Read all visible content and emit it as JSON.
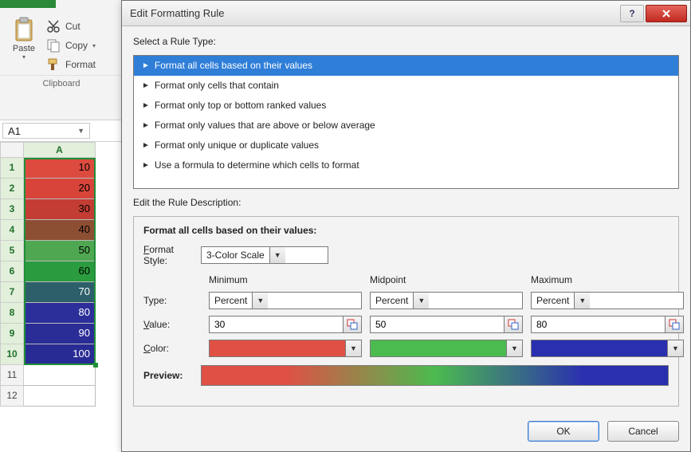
{
  "ribbon": {
    "paste_label": "Paste",
    "cut_label": "Cut",
    "copy_label": "Copy",
    "format_label": "Format",
    "clipboard_label": "Clipboard"
  },
  "name_box": "A1",
  "grid": {
    "col": "A",
    "rows": [
      {
        "n": "1",
        "v": "10",
        "bg": "#dd4a3e",
        "fg": "#000"
      },
      {
        "n": "2",
        "v": "20",
        "bg": "#d8443a",
        "fg": "#000"
      },
      {
        "n": "3",
        "v": "30",
        "bg": "#c33d34",
        "fg": "#000"
      },
      {
        "n": "4",
        "v": "40",
        "bg": "#8d4f33",
        "fg": "#000"
      },
      {
        "n": "5",
        "v": "50",
        "bg": "#4fa851",
        "fg": "#000"
      },
      {
        "n": "6",
        "v": "60",
        "bg": "#2a9b3e",
        "fg": "#000"
      },
      {
        "n": "7",
        "v": "70",
        "bg": "#2d5f6a",
        "fg": "#fff"
      },
      {
        "n": "8",
        "v": "80",
        "bg": "#2c2f99",
        "fg": "#fff"
      },
      {
        "n": "9",
        "v": "90",
        "bg": "#2a2d96",
        "fg": "#fff"
      },
      {
        "n": "10",
        "v": "100",
        "bg": "#282b93",
        "fg": "#fff"
      },
      {
        "n": "11",
        "v": "",
        "bg": "#ffffff",
        "fg": "#000"
      },
      {
        "n": "12",
        "v": "",
        "bg": "#ffffff",
        "fg": "#000"
      }
    ]
  },
  "dialog": {
    "title": "Edit Formatting Rule",
    "select_label": "Select a Rule Type:",
    "rules": [
      "Format all cells based on their values",
      "Format only cells that contain",
      "Format only top or bottom ranked values",
      "Format only values that are above or below average",
      "Format only unique or duplicate values",
      "Use a formula to determine which cells to format"
    ],
    "selected_rule_index": 0,
    "edit_desc_label": "Edit the Rule Description:",
    "desc_title": "Format all cells based on their values:",
    "format_style_label": "Format Style:",
    "format_style_value": "3-Color Scale",
    "columns": {
      "min": "Minimum",
      "mid": "Midpoint",
      "max": "Maximum"
    },
    "type_label": "Type:",
    "value_label": "Value:",
    "color_label": "Color:",
    "preview_label": "Preview:",
    "min": {
      "type": "Percent",
      "value": "30",
      "color": "#e05045"
    },
    "mid": {
      "type": "Percent",
      "value": "50",
      "color": "#4cbb4f"
    },
    "max": {
      "type": "Percent",
      "value": "80",
      "color": "#2a2fb0"
    },
    "preview_gradient": "linear-gradient(to right, #e05045 0%, #e05045 18%, #4cbb4f 50%, #2a2fb0 82%, #2a2fb0 100%)",
    "ok": "OK",
    "cancel": "Cancel"
  }
}
